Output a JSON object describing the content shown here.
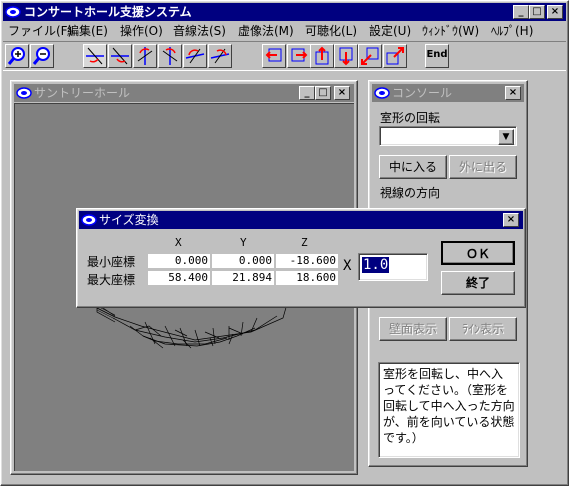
{
  "app": {
    "title": "コンサートホール支援システム",
    "icon": "cloud-app-icon"
  },
  "menu": [
    "ファイル(F)",
    "編集(E)",
    "操作(O)",
    "音線法(S)",
    "虚像法(M)",
    "可聴化(L)",
    "設定(U)",
    "ｳｨﾝﾄﾞｳ(W)",
    "ﾍﾙﾌﾟ(H)"
  ],
  "toolbar": {
    "end_label": "End"
  },
  "hall_window": {
    "title": "サントリーホール"
  },
  "console": {
    "title": "コンソール",
    "rotate_label": "室形の回転",
    "rotate_value": "",
    "enter_label": "中に入る",
    "exit_label": "外に出る",
    "view_dir_label": "視線の方向",
    "wall_display_label": "壁面表示",
    "line_display_label": "ﾗｲﾝ表示",
    "help_text": "室形を回転し、中へ入ってください。（室形を回転して中へ入った方向が、前を向いている状態です。）"
  },
  "dialog": {
    "title": "サイズ変換",
    "col_x": "X",
    "col_y": "Y",
    "col_z": "Z",
    "min_label": "最小座標",
    "max_label": "最大座標",
    "min_x": "0.000",
    "min_y": "0.000",
    "min_z": "-18.600",
    "max_x": "58.400",
    "max_y": "21.894",
    "max_z": "18.600",
    "scale_label": "X",
    "scale_value": "1.0",
    "ok_label": "ＯＫ",
    "end_label": "終了"
  },
  "colors": {
    "title_active": "#000080",
    "title_inactive": "#808080",
    "face": "#c0c0c0",
    "desktop": "#808080",
    "accent_red": "#ff0000",
    "accent_blue": "#0000ff"
  }
}
